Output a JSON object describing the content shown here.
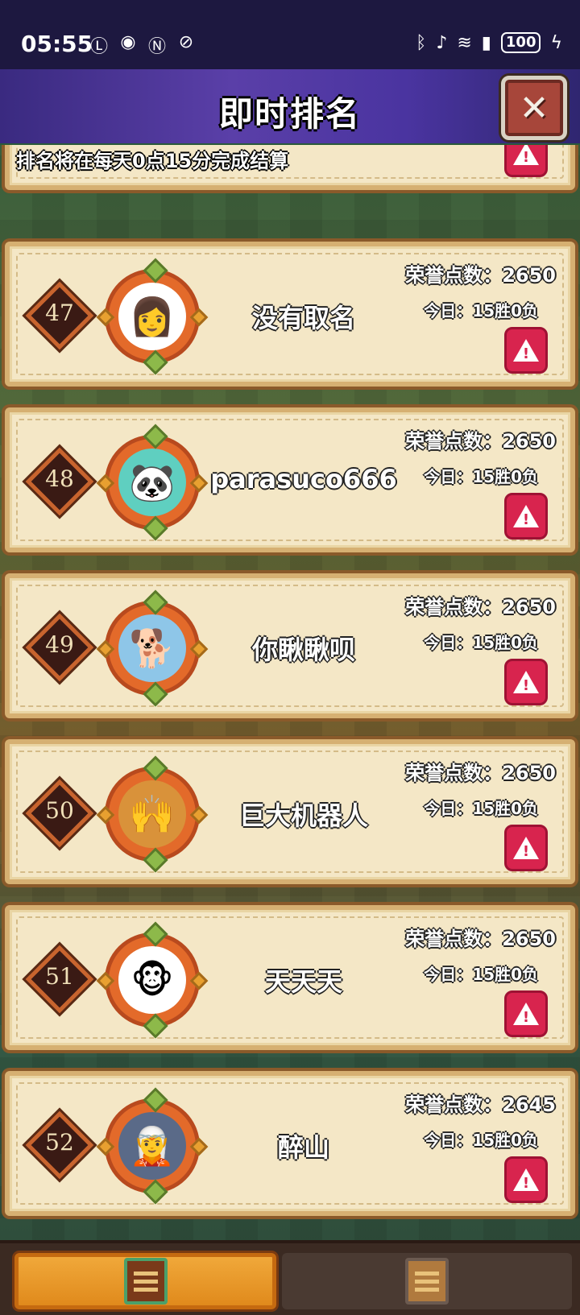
{
  "status_bar": {
    "time": "05:55",
    "left_icons": [
      "notification-icon",
      "eye-icon",
      "nfc-icon",
      "alarm-icon"
    ],
    "right_icons": [
      "bluetooth-icon",
      "mute-icon",
      "wifi-icon",
      "signal-icon"
    ],
    "battery": "100"
  },
  "header": {
    "title": "即时排名",
    "close_label": "✕"
  },
  "notice": "排名将在每天0点15分完成结算",
  "players": [
    {
      "rank": "47",
      "name": "没有取名",
      "honor": "荣誉点数：2650",
      "today": "今日：15胜0负",
      "avatar_icon": "lady-avatar-icon",
      "avatar_glyph": "👩",
      "avatar_bg": "#ffffff"
    },
    {
      "rank": "48",
      "name": "parasuco666",
      "honor": "荣誉点数：2650",
      "today": "今日：15胜0负",
      "avatar_icon": "panda-reaper-avatar-icon",
      "avatar_glyph": "🐼",
      "avatar_bg": "#5fcfc0"
    },
    {
      "rank": "49",
      "name": "你瞅瞅呗",
      "honor": "荣誉点数：2650",
      "today": "今日：15胜0负",
      "avatar_icon": "shiba-dog-avatar-icon",
      "avatar_glyph": "🐕",
      "avatar_bg": "#8ec6e8"
    },
    {
      "rank": "50",
      "name": "巨大机器人",
      "honor": "荣誉点数：2650",
      "today": "今日：15胜0负",
      "avatar_icon": "sunset-silhouette-avatar-icon",
      "avatar_glyph": "🙌",
      "avatar_bg": "#d9923a"
    },
    {
      "rank": "51",
      "name": "天天天",
      "honor": "荣誉点数：2650",
      "today": "今日：15胜0负",
      "avatar_icon": "monkey-king-avatar-icon",
      "avatar_glyph": "🐵",
      "avatar_bg": "#ffffff"
    },
    {
      "rank": "52",
      "name": "醉山",
      "honor": "荣誉点数：2645",
      "today": "今日：15胜0负",
      "avatar_icon": "warrior-avatar-icon",
      "avatar_glyph": "🧝",
      "avatar_bg": "#5a6a88"
    }
  ],
  "tabs": [
    {
      "icon": "ranking-board-icon",
      "active": true
    },
    {
      "icon": "scroll-board-icon",
      "active": false
    }
  ],
  "colors": {
    "header": "#4a34a0",
    "card": "#f4e7c6",
    "report": "#d8244e",
    "active_tab": "#e08a1c"
  }
}
